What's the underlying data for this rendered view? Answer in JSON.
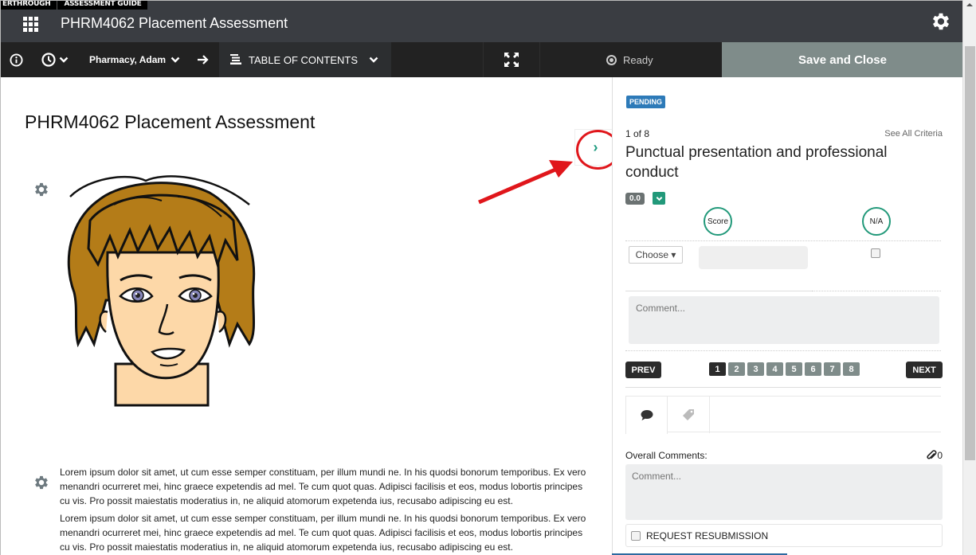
{
  "walkthrough_tabs": [
    "ERTHROUGH",
    "ASSESSMENT GUIDE"
  ],
  "header": {
    "title": "PHRM4062 Placement Assessment",
    "apps_icon": "grid-icon",
    "settings_icon": "gear-icon"
  },
  "toolbar": {
    "info_icon": "info-icon",
    "history_icon": "clock-icon",
    "user_name": "Pharmacy, Adam",
    "next_icon": "arrow-right-icon",
    "toc_label": "TABLE OF CONTENTS",
    "expand_icon": "expand-icon",
    "status": "Ready",
    "save_label": "Save and Close"
  },
  "document": {
    "title": "PHRM4062 Placement Assessment",
    "paragraphs": [
      "Lorem ipsum dolor sit amet, ut cum esse semper constituam, per illum mundi ne. In his quodsi bonorum temporibus. Ex vero menandri ocurreret mei, hinc graece expetendis ad mel. Te cum quot quas. Adipisci facilisis et eos, modus lobortis principes cu vis. Pro possit maiestatis moderatius in, ne aliquid atomorum expetenda ius, recusabo adipiscing eu est.",
      "Lorem ipsum dolor sit amet, ut cum esse semper constituam, per illum mundi ne. In his quodsi bonorum temporibus. Ex vero menandri ocurreret mei, hinc graece expetendis ad mel. Te cum quot quas. Adipisci facilisis et eos, modus lobortis principes cu vis. Pro possit maiestatis moderatius in, ne aliquid atomorum expetenda ius, recusabo adipiscing eu est."
    ]
  },
  "panel": {
    "status_badge": "PENDING",
    "criteria_position": "1 of 8",
    "see_all": "See All Criteria",
    "criteria_title": "Punctual presentation and professional conduct",
    "score_value": "0.0",
    "columns": [
      "Score",
      "N/A"
    ],
    "choose_label": "Choose ▾",
    "na_checked": false,
    "comment_placeholder": "Comment...",
    "prev_label": "PREV",
    "next_label": "NEXT",
    "pages": [
      "1",
      "2",
      "3",
      "4",
      "5",
      "6",
      "7",
      "8"
    ],
    "current_page": "1",
    "tabs": [
      "comment-icon",
      "tag-icon"
    ],
    "overall_label": "Overall Comments:",
    "attachment_count": "0",
    "overall_placeholder": "Comment...",
    "resubmission_label": "REQUEST RESUBMISSION",
    "resubmission_checked": false
  },
  "colors": {
    "accent": "#22997a",
    "badge_blue": "#2d7ab8",
    "save_bg": "#7f8c8a",
    "header_bg": "#3a3d42",
    "toolbar_bg": "#222222",
    "annotation_red": "#e0161b"
  }
}
